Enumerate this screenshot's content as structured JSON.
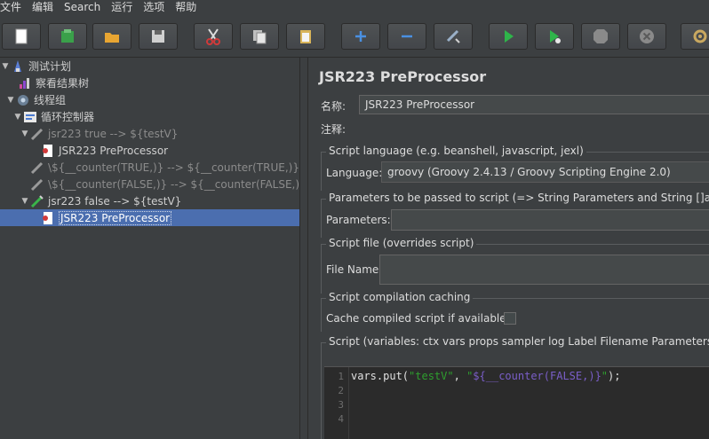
{
  "menu": [
    "文件",
    "编辑",
    "Search",
    "运行",
    "选项",
    "帮助"
  ],
  "toolbar": {
    "buttons": [
      {
        "name": "new-icon",
        "color": "#ffffff"
      },
      {
        "name": "templates-icon",
        "color": "#3aa04a"
      },
      {
        "name": "open-icon",
        "color": "#e8a532"
      },
      {
        "name": "save-icon",
        "color": "#d0d0d0"
      },
      {
        "name": "cut-icon",
        "color": "#d13a3a"
      },
      {
        "name": "copy-icon",
        "color": "#d0d0d0"
      },
      {
        "name": "paste-icon",
        "color": "#d8b45a"
      },
      {
        "name": "expand-icon",
        "color": "#4a90e2"
      },
      {
        "name": "collapse-icon",
        "color": "#4a90e2"
      },
      {
        "name": "toggle-icon",
        "color": "#9ab0c8"
      },
      {
        "name": "start-icon",
        "color": "#2fb54a"
      },
      {
        "name": "start-no-pause-icon",
        "color": "#2fb54a"
      },
      {
        "name": "stop-icon",
        "color": "#8a8a8a"
      },
      {
        "name": "shutdown-icon",
        "color": "#8a8a8a"
      },
      {
        "name": "clear-icon",
        "color": "#c9a860"
      }
    ]
  },
  "tree": {
    "items": [
      {
        "label": "测试计划",
        "icon": "test-plan-icon"
      },
      {
        "label": "察看结果树",
        "icon": "results-tree-icon"
      },
      {
        "label": "线程组",
        "icon": "thread-group-icon"
      },
      {
        "label": "循环控制器",
        "icon": "loop-controller-icon"
      },
      {
        "label": "jsr223 true   --> ${testV}",
        "icon": "sampler-icon"
      },
      {
        "label": "JSR223 PreProcessor",
        "icon": "preprocessor-icon"
      },
      {
        "label": "\\${__counter(TRUE,)} --> ${__counter(TRUE,)}",
        "icon": "sampler-icon"
      },
      {
        "label": "\\${__counter(FALSE,)} --> ${__counter(FALSE,)}",
        "icon": "sampler-icon"
      },
      {
        "label": "jsr223 false   --> ${testV}",
        "icon": "sampler-icon"
      },
      {
        "label": "JSR223 PreProcessor",
        "icon": "preprocessor-icon"
      }
    ]
  },
  "panel": {
    "title": "JSR223 PreProcessor",
    "name_label": "名称:",
    "name_value": "JSR223 PreProcessor",
    "comment_label": "注释:",
    "comment_value": "",
    "script_language": {
      "title": "Script language (e.g. beanshell, javascript, jexl)",
      "label": "Language:",
      "value": "groovy     (Groovy 2.4.13 / Groovy Scripting Engine 2.0)"
    },
    "parameters": {
      "title": "Parameters to be passed to script (=> String Parameters and String []args)",
      "label": "Parameters:",
      "value": ""
    },
    "script_file": {
      "title": "Script file (overrides script)",
      "label": "File Name:",
      "value": ""
    },
    "caching": {
      "title": "Script compilation caching",
      "label": "Cache compiled script if available:"
    },
    "script": {
      "title": "Script (variables: ctx vars props sampler log Label Filename Parameters args",
      "line_numbers": [
        "1",
        "2",
        "3",
        "4"
      ],
      "code_prefix": "vars.put(",
      "code_key": "\"testV\"",
      "code_sep": ", ",
      "code_q1": "\"",
      "code_value": "${__counter(FALSE,)}",
      "code_q2": "\"",
      "code_suffix": ");"
    }
  }
}
